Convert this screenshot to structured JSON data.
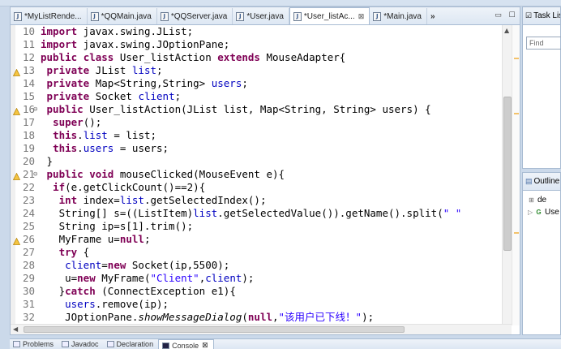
{
  "editor": {
    "tabs": [
      {
        "label": "*MyListRende...",
        "active": false
      },
      {
        "label": "*QQMain.java",
        "active": false
      },
      {
        "label": "*QQServer.java",
        "active": false
      },
      {
        "label": "*User.java",
        "active": false
      },
      {
        "label": "*User_listAc...",
        "active": true
      },
      {
        "label": "*Main.java",
        "active": false
      }
    ],
    "overflow_label": "»",
    "minimize": "▭",
    "maximize": "☐",
    "lines": [
      {
        "num": "10",
        "text": "import javax.swing.JList;"
      },
      {
        "num": "11",
        "text": "import javax.swing.JOptionPane;"
      },
      {
        "num": "12",
        "text": "public class User_listAction extends MouseAdapter{"
      },
      {
        "num": "13",
        "text": " private JList list;"
      },
      {
        "num": "14",
        "text": " private Map<String,String> users;"
      },
      {
        "num": "15",
        "text": " private Socket client;"
      },
      {
        "num": "16",
        "text": " public User_listAction(JList list, Map<String, String> users) {"
      },
      {
        "num": "17",
        "text": "  super();"
      },
      {
        "num": "18",
        "text": "  this.list = list;"
      },
      {
        "num": "19",
        "text": "  this.users = users;"
      },
      {
        "num": "20",
        "text": " }"
      },
      {
        "num": "21",
        "text": " public void mouseClicked(MouseEvent e){"
      },
      {
        "num": "22",
        "text": "  if(e.getClickCount()==2){"
      },
      {
        "num": "23",
        "text": "   int index=list.getSelectedIndex();"
      },
      {
        "num": "24",
        "text": "   String[] s=((ListItem)list.getSelectedValue()).getName().split(\" \""
      },
      {
        "num": "25",
        "text": "   String ip=s[1].trim();"
      },
      {
        "num": "26",
        "text": "   MyFrame u=null;"
      },
      {
        "num": "27",
        "text": "   try {"
      },
      {
        "num": "28",
        "text": "    client=new Socket(ip,5500);"
      },
      {
        "num": "29",
        "text": "    u=new MyFrame(\"Client\",client);"
      },
      {
        "num": "30",
        "text": "   }catch (ConnectException e1){"
      },
      {
        "num": "31",
        "text": "    users.remove(ip);"
      },
      {
        "num": "32",
        "text": "    JOptionPane.showMessageDialog(null,\"该用户已下线！\");"
      }
    ]
  },
  "side": {
    "task_title": "Task Lis",
    "find_placeholder": "Find",
    "outline_title": "Outline",
    "outline_items": [
      "de",
      "Use"
    ]
  },
  "bottom": {
    "tabs": [
      "Problems",
      "Javadoc",
      "Declaration",
      "Console"
    ],
    "active": "Console",
    "console_close": "⊠"
  },
  "colors": {
    "keyword": "#7f0055",
    "field": "#0000c0",
    "string": "#2a00ff",
    "line_number": "#787878",
    "chrome": "#cbd9ea"
  }
}
